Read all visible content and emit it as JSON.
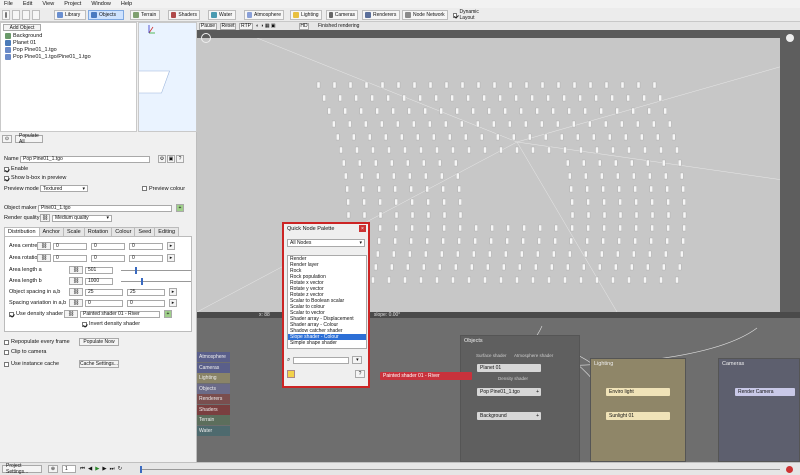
{
  "menu": [
    "File",
    "Edit",
    "View",
    "Project",
    "Window",
    "Help"
  ],
  "toolbar": {
    "tabs": [
      "Library",
      "Objects",
      "Terrain",
      "Shaders",
      "Water",
      "Atmosphere",
      "Lighting",
      "Cameras",
      "Renderers",
      "Node Network",
      "Dynamic Layout"
    ],
    "selected_tab": "Objects"
  },
  "scene": {
    "add_object": "Add Object",
    "tree": [
      "Background",
      "Planet 01",
      "Pop Pine01_1.tgo",
      "Pop Pine01_1.tgo/Pine01_1.tgo"
    ],
    "populate_all": "Populate All"
  },
  "props": {
    "name_label": "Name",
    "name_value": "Pop Pine01_1.tgo",
    "enable": "Enable",
    "show_bbox": "Show b-box in preview",
    "preview_mode_label": "Preview mode",
    "preview_mode_value": "Textured",
    "preview_colour": "Preview colour",
    "object_maker_label": "Object maker",
    "object_maker_value": "Pine01_1.tgo",
    "render_quality_label": "Render quality",
    "render_quality_value": "Medium quality",
    "tabs": [
      "Distribution",
      "Anchor",
      "Scale",
      "Rotation",
      "Colour",
      "Seed",
      "Editing"
    ],
    "area_centre": "Area centre",
    "area_rotation": "Area rotation",
    "zero": "0",
    "area_length_a": "Area length a",
    "area_length_a_value": "501",
    "area_length_b": "Area length b",
    "area_length_b_value": "1000",
    "object_spacing": "Object spacing in a,b",
    "spacing_value": "25",
    "spacing_variation": "Spacing variation in a,b",
    "use_density_shader": "Use density shader",
    "density_shader_value": "Painted shader 01 - River",
    "invert_density": "Invert density shader",
    "repopulate": "Repopulate every frame",
    "populate_now": "Populate Now",
    "clip_to_camera": "Clip to camera",
    "use_instance_cache": "Use instance cache",
    "cache_settings": "Cache Settings..."
  },
  "viewport": {
    "buttons": [
      "Pause",
      "Reset",
      "RTP",
      "HD"
    ],
    "status": "Finished rendering",
    "slope": "slope: 0.00°",
    "coord": "x: 88"
  },
  "node_categories": [
    {
      "label": "Atmosphere",
      "color": "#5a5f8a"
    },
    {
      "label": "Cameras",
      "color": "#5a5f8a"
    },
    {
      "label": "Lighting",
      "color": "#8a8468"
    },
    {
      "label": "Objects",
      "color": "#6b6b88"
    },
    {
      "label": "Renderers",
      "color": "#7a4e4e"
    },
    {
      "label": "Shaders",
      "color": "#7a3f3f"
    },
    {
      "label": "Terrain",
      "color": "#5c6e5c"
    },
    {
      "label": "Water",
      "color": "#4e6a6e"
    }
  ],
  "nodes": {
    "objects_group": "Objects",
    "surface_shader": "Surface shader",
    "atmosphere_shader": "Atmosphere shader",
    "planet": "Planet 01",
    "density_shader": "Density shader",
    "pop": "Pop Pine01_1.tgo",
    "background": "Background",
    "painted": "Painted shader 01 - River",
    "lighting_group": "Lighting",
    "enviro": "Enviro light",
    "sunlight": "Sunlight 01",
    "cameras_group": "Cameras",
    "render_camera": "Render Camera"
  },
  "palette": {
    "title": "Quick Node Palette",
    "filter": "All Nodes",
    "items": [
      "Render",
      "Render layer",
      "Rock",
      "Rock population",
      "Rotate x vector",
      "Rotate y vector",
      "Rotate z vector",
      "Scalar to Boolean scalar",
      "Scalar to colour",
      "Scalar to vector",
      "Shader array - Displacement",
      "Shader array - Colour",
      "Shadow catcher shader",
      "Slope shader - Colour",
      "Simple shape shader"
    ],
    "selected": "Slope shader - Colour",
    "help": "?"
  },
  "status": {
    "project_settings": "Project Settings...",
    "frame": "1"
  },
  "colors": {
    "accent": "#cfe3ff",
    "popup_border": "#cc2424",
    "node_red": "#c8323c",
    "objects_group": "#6e6e6e",
    "lighting_group": "#8f8668"
  }
}
